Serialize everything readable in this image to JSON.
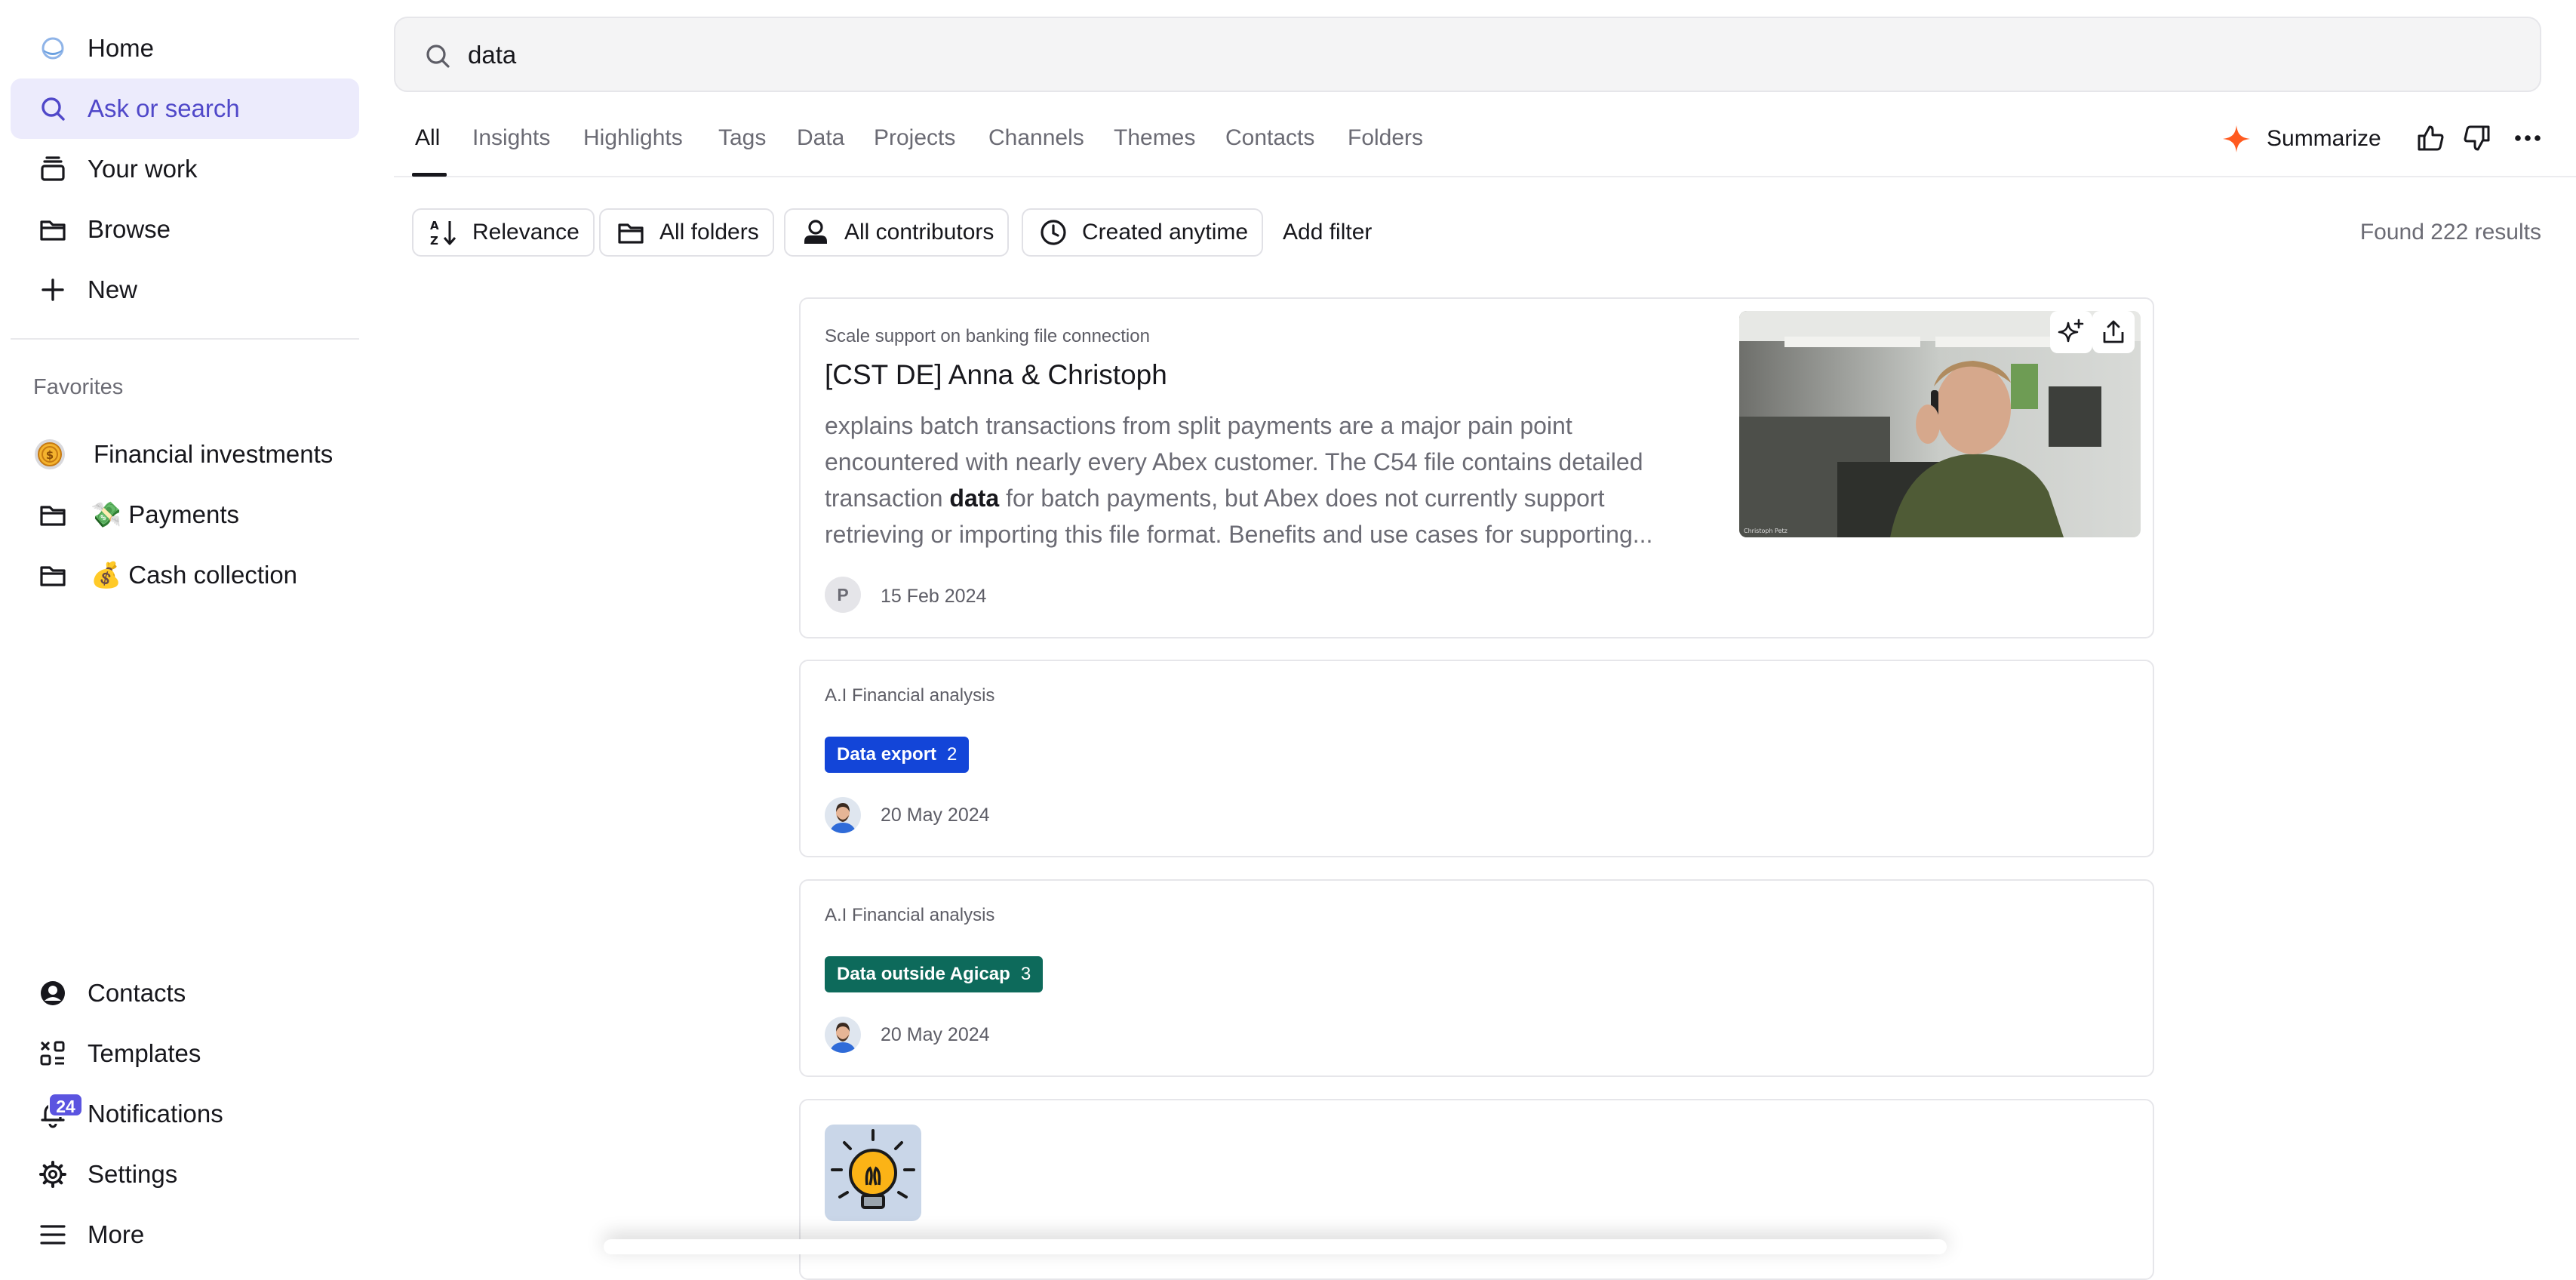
{
  "sidebar": {
    "nav": [
      {
        "label": "Home",
        "icon": "home-icon"
      },
      {
        "label": "Ask or search",
        "icon": "search-icon",
        "active": true
      },
      {
        "label": "Your work",
        "icon": "stack-icon"
      },
      {
        "label": "Browse",
        "icon": "folder-icon"
      },
      {
        "label": "New",
        "icon": "plus-icon"
      }
    ],
    "favorites_title": "Favorites",
    "favorites": [
      {
        "label": "Financial investments",
        "icon": "coin-icon"
      },
      {
        "label": "💸 Payments",
        "icon": "folder-icon"
      },
      {
        "label": "💰 Cash collection",
        "icon": "folder-icon"
      }
    ],
    "bottom": [
      {
        "label": "Contacts",
        "icon": "user-circle-icon"
      },
      {
        "label": "Templates",
        "icon": "templates-icon"
      },
      {
        "label": "Notifications",
        "icon": "bell-icon",
        "badge": "24"
      },
      {
        "label": "Settings",
        "icon": "gear-icon"
      },
      {
        "label": "More",
        "icon": "menu-icon"
      }
    ]
  },
  "search": {
    "value": "data"
  },
  "tabs": [
    "All",
    "Insights",
    "Highlights",
    "Tags",
    "Data",
    "Projects",
    "Channels",
    "Themes",
    "Contacts",
    "Folders"
  ],
  "active_tab": "All",
  "header_actions": {
    "summarize": "Summarize"
  },
  "filters": {
    "chips": [
      {
        "label": "Relevance",
        "icon": "sort-icon"
      },
      {
        "label": "All folders",
        "icon": "folder-icon"
      },
      {
        "label": "All contributors",
        "icon": "user-icon"
      },
      {
        "label": "Created anytime",
        "icon": "clock-icon"
      }
    ],
    "add_filter": "Add filter",
    "found": "Found 222 results"
  },
  "results": [
    {
      "context": "Scale support on banking file connection",
      "title": "[CST DE] Anna & Christoph",
      "snippet_before": "explains batch transactions from split payments are a major pain point encountered with nearly every Abex customer. The C54 file contains detailed transaction ",
      "snippet_highlight": "data",
      "snippet_after": " for batch payments, but Abex does not currently support retrieving or importing this file format. Benefits and use cases for supporting...",
      "avatar_initial": "P",
      "date": "15 Feb 2024"
    },
    {
      "context": "A.I Financial analysis",
      "tag": {
        "label": "Data export",
        "count": "2",
        "color": "#1345d8"
      },
      "date": "20 May 2024"
    },
    {
      "context": "A.I Financial analysis",
      "tag": {
        "label": "Data outside Agicap",
        "count": "3",
        "color": "#0d6a5b"
      },
      "date": "20 May 2024"
    }
  ],
  "colors": {
    "accent": "#5b54e0",
    "summarize_star": "#ff5a1f",
    "active_bg": "#ecebfc"
  }
}
